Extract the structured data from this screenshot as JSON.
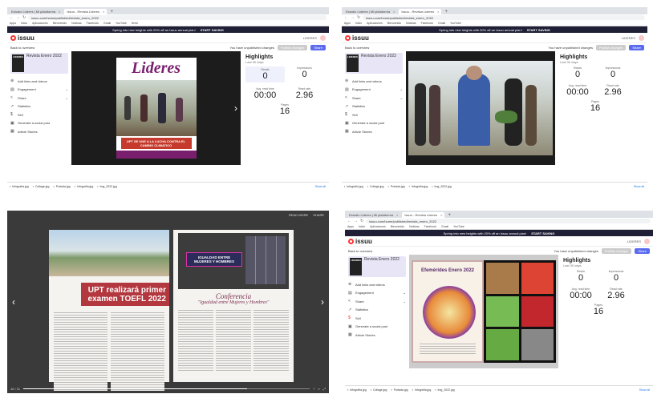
{
  "q1": {
    "tabs": [
      "Estudio Lideres | Mi plataforma",
      "Issuu - Revista Lideres"
    ],
    "url": "issuu.com/home/published/revista_enero_2022",
    "bookmarks": [
      "Apps",
      "Inicio",
      "Aplicaciones",
      "Bienvenido",
      "Noticias",
      "Facebook",
      "Gmail",
      "YouTube",
      "Drive",
      "Maps",
      "Google"
    ],
    "promo_text": "Spring into new heights with 20% off an Issuu annual plan!",
    "promo_cta": "START SAVING",
    "back": "Back to overview",
    "unpublished": "You have unpublished changes",
    "publish": "Publish changes",
    "share": "Share",
    "pub_title": "Revista Enero 2022",
    "menu": [
      "Add links and videos",
      "Engagement",
      "Share",
      "Statistics",
      "Sell",
      "Generate a social post",
      "Article Stories"
    ],
    "cover_title": "Lideres",
    "cover_caption": "UPT SE UNE A LA LUCHA CONTRA EL CAMBIO CLIMATICO",
    "highlights": "Highlights",
    "period": "Last 30 days",
    "reads_label": "Reads",
    "reads": "0",
    "impr_label": "Impressions",
    "impr": "0",
    "avg_label": "Avg. read time",
    "avg": "00:00",
    "read_label": "Read rate",
    "read": "2.96",
    "pages_label": "Pages",
    "pages": "16",
    "downloads": [
      "Infografía.jpg",
      "Collage.jpg",
      "Portada.jpg",
      "Infografía.jpg",
      "Img_2022.jpg"
    ],
    "show_all": "Show all"
  },
  "q2": {
    "tabs": [
      "Estudio Lideres | Mi plataforma",
      "Issuu - Revista Lideres"
    ],
    "url": "issuu.com/home/published/revista_enero_2022",
    "bookmarks": [
      "Apps",
      "Inicio",
      "Aplicaciones",
      "Bienvenido",
      "Noticias",
      "Facebook",
      "Gmail",
      "YouTube",
      "Drive",
      "Maps",
      "Google"
    ],
    "promo_text": "Spring into new heights with 20% off an Issuu annual plan!",
    "promo_cta": "START SAVING",
    "back": "Back to overview",
    "unpublished": "You have unpublished changes",
    "publish": "Publish changes",
    "share": "Share",
    "pub_title": "Revista Enero 2022",
    "menu": [
      "Add links and videos",
      "Engagement",
      "Share",
      "Statistics",
      "Sell",
      "Generate a social post",
      "Article Stories"
    ],
    "highlights": "Highlights",
    "period": "Last 30 days",
    "reads_label": "Reads",
    "reads": "0",
    "impr_label": "Impressions",
    "impr": "0",
    "avg_label": "Avg. read time",
    "avg": "00:00",
    "read_label": "Read rate",
    "read": "2.96",
    "pages_label": "Pages",
    "pages": "16",
    "downloads": [
      "Infografía.jpg",
      "Collage.jpg",
      "Portada.jpg",
      "Infografía.jpg",
      "Img_2022.jpg"
    ],
    "show_all": "Show all"
  },
  "q3": {
    "top_right": [
      "READ MORE",
      "SHARE"
    ],
    "left_headline_1": "UPT realizará primer",
    "left_headline_2": "examen TOEFL 2022",
    "poster_title": "IGUALDAD ENTRE MUJERES Y HOMBRES",
    "right_headline_1": "Conferencia",
    "right_headline_2": "\"Igualdad entre Mujeres y Hombres\"",
    "page_indicator": "10 / 11"
  },
  "q4": {
    "tabs": [
      "Estudio Lideres | Mi plataforma",
      "Issuu - Revista Lideres"
    ],
    "url": "issuu.com/home/published/revista_enero_2022",
    "bookmarks": [
      "Apps",
      "Inicio",
      "Aplicaciones",
      "Bienvenido",
      "Noticias",
      "Facebook",
      "Gmail",
      "YouTube",
      "Drive",
      "Maps",
      "Google"
    ],
    "promo_text": "Spring into new heights with 20% off an Issuu annual plan!",
    "promo_cta": "START SAVING",
    "back": "Back to overview",
    "unpublished": "You have unpublished changes",
    "publish": "Publish changes",
    "share": "Share",
    "pub_title": "Revista Enero 2022",
    "menu": [
      "Add links and videos",
      "Engagement",
      "Share",
      "Statistics",
      "Sell",
      "Generate a social post",
      "Article Stories"
    ],
    "spread_title": "Efemérides Enero 2022",
    "highlights": "Highlights",
    "period": "Last 30 days",
    "reads_label": "Reads",
    "reads": "0",
    "impr_label": "Impressions",
    "impr": "0",
    "avg_label": "Avg. read time",
    "avg": "00:00",
    "read_label": "Read rate",
    "read": "2.96",
    "pages_label": "Pages",
    "pages": "16",
    "downloads": [
      "Infografía.jpg",
      "Collage.jpg",
      "Portada.jpg",
      "Infografía.jpg",
      "Img_2022.jpg"
    ],
    "show_all": "Show all"
  }
}
